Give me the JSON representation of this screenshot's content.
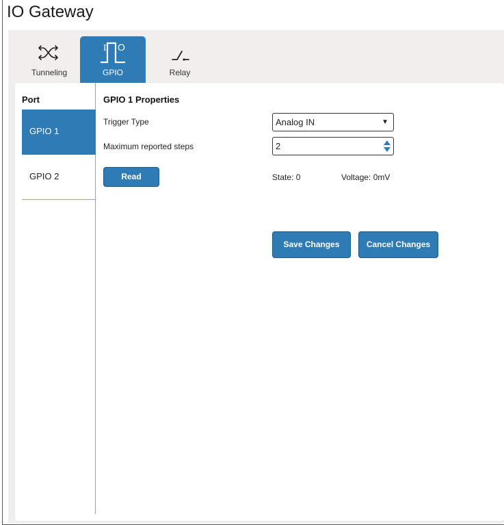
{
  "app": {
    "title": "IO Gateway"
  },
  "tabs": [
    {
      "label": "Tunneling",
      "icon": "shuffle-icon"
    },
    {
      "label": "GPIO",
      "icon": "gpio-pulse-icon"
    },
    {
      "label": "Relay",
      "icon": "relay-switch-icon"
    }
  ],
  "ports": {
    "heading": "Port",
    "items": [
      {
        "label": "GPIO 1"
      },
      {
        "label": "GPIO 2"
      }
    ]
  },
  "properties": {
    "heading": "GPIO 1 Properties",
    "trigger_type_label": "Trigger Type",
    "trigger_type_value": "Analog IN",
    "max_steps_label": "Maximum reported steps",
    "max_steps_value": "2",
    "read_label": "Read",
    "state_text": "State:  0",
    "voltage_text": "Voltage:  0mV"
  },
  "actions": {
    "save_label": "Save Changes",
    "cancel_label": "Cancel Changes"
  },
  "colors": {
    "accent": "#2e7bb5",
    "tabbar_bg": "#f1efee"
  }
}
